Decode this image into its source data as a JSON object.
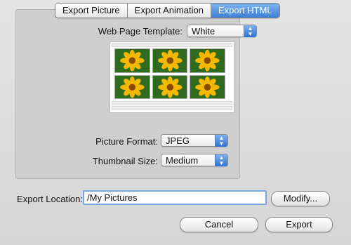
{
  "tabs": [
    "Export Picture",
    "Export Animation",
    "Export HTML"
  ],
  "active_tab": "Export HTML",
  "template": {
    "label": "Web Page Template:",
    "value": "White"
  },
  "picture_format": {
    "label": "Picture Format:",
    "value": "JPEG"
  },
  "thumbnail_size": {
    "label": "Thumbnail Size:",
    "value": "Medium"
  },
  "export_location": {
    "label": "Export Location:",
    "value": "/My Pictures"
  },
  "buttons": {
    "modify": "Modify...",
    "cancel": "Cancel",
    "export": "Export"
  },
  "colors": {
    "accent": "#3b7fd6",
    "petal": "#f5b800",
    "leaf": "#2e6b1e"
  }
}
